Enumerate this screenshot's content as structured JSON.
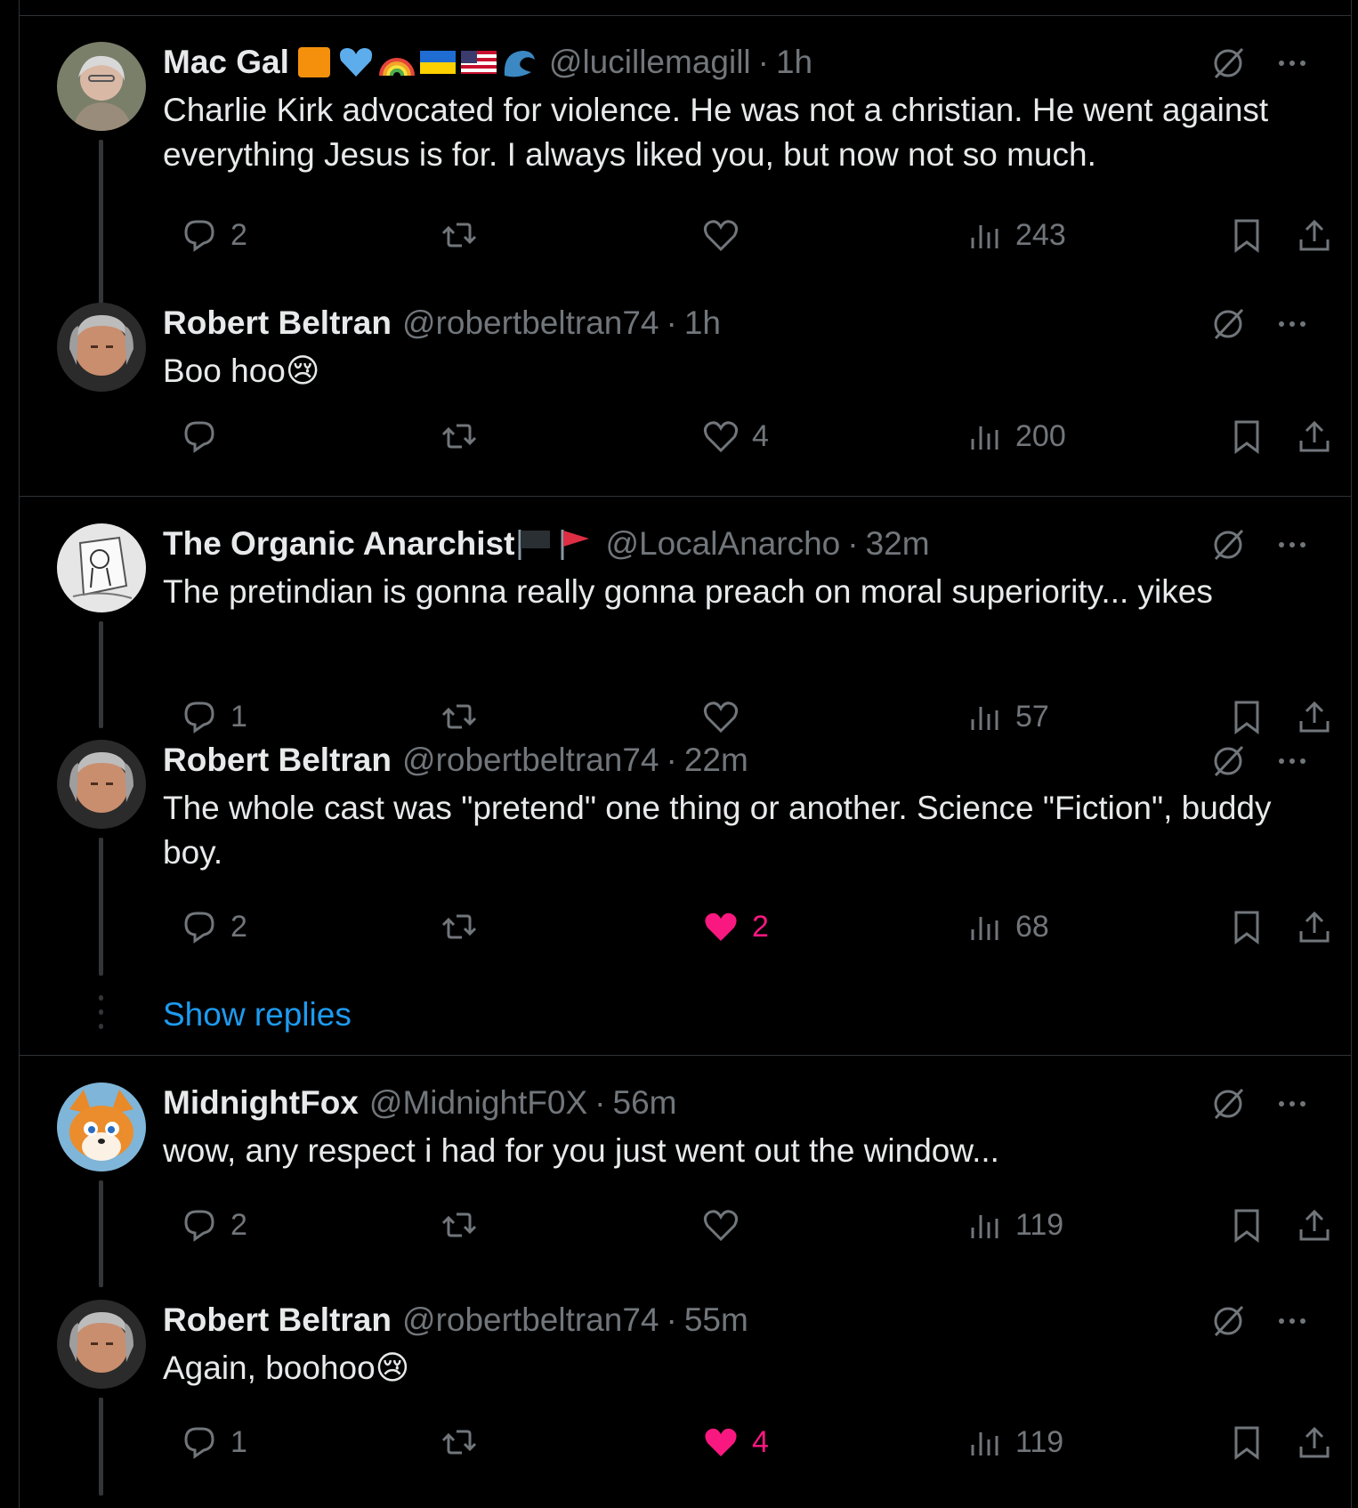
{
  "threads": [
    {
      "tweets": [
        {
          "name": "Mac Gal",
          "handle": "@lucillemagill",
          "time": "1h",
          "text": "Charlie Kirk advocated for violence.  He was not a christian.  He went against everything Jesus is for.  I always liked you, but now not so much.",
          "replies": "2",
          "retweets": "",
          "likes": "",
          "views": "243",
          "liked": false
        },
        {
          "name": "Robert Beltran",
          "handle": "@robertbeltran74",
          "time": "1h",
          "text": "Boo hoo😢",
          "replies": "",
          "retweets": "",
          "likes": "4",
          "views": "200",
          "liked": false
        }
      ]
    },
    {
      "tweets": [
        {
          "name": "The Organic Anarchist",
          "handle": "@LocalAnarcho",
          "time": "32m",
          "text": "The pretindian is gonna really gonna preach on moral superiority... yikes",
          "replies": "1",
          "retweets": "",
          "likes": "",
          "views": "57",
          "liked": false
        },
        {
          "name": "Robert Beltran",
          "handle": "@robertbeltran74",
          "time": "22m",
          "text": "The whole cast was \"pretend\" one thing or another. Science \"Fiction\", buddy boy.",
          "replies": "2",
          "retweets": "",
          "likes": "2",
          "views": "68",
          "liked": true
        }
      ],
      "show_replies": "Show replies"
    },
    {
      "tweets": [
        {
          "name": "MidnightFox",
          "handle": "@MidnightF0X",
          "time": "56m",
          "text": "wow, any respect i had for you just went out the window...",
          "replies": "2",
          "retweets": "",
          "likes": "",
          "views": "119",
          "liked": false
        },
        {
          "name": "Robert Beltran",
          "handle": "@robertbeltran74",
          "time": "55m",
          "text": "Again, boohoo😢",
          "replies": "1",
          "retweets": "",
          "likes": "4",
          "views": "119",
          "liked": true
        }
      ]
    }
  ],
  "ui": {
    "separator": "·"
  },
  "colors": {
    "background": "#000000",
    "muted": "#71767b",
    "like": "#f91880",
    "link": "#1d9bf0",
    "border": "#2f3336"
  }
}
